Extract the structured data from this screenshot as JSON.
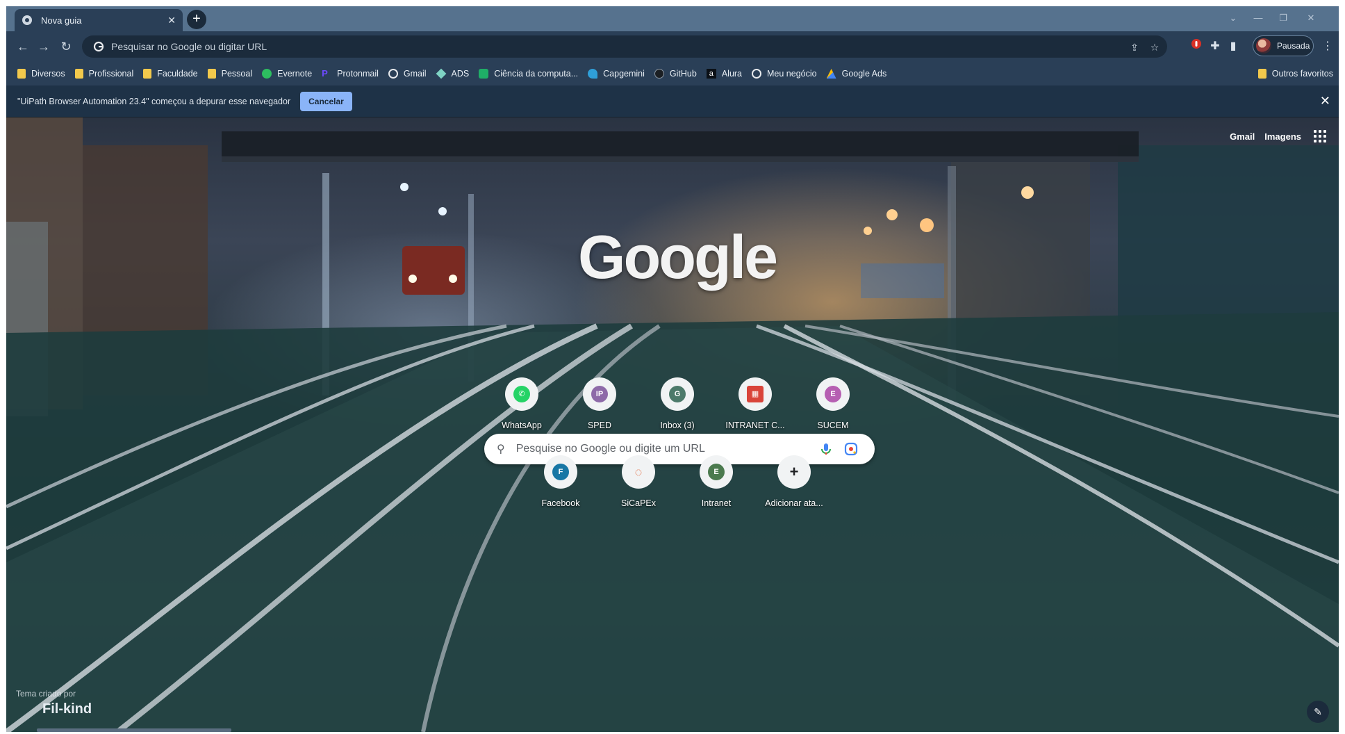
{
  "tab": {
    "title": "Nova guia",
    "close": "✕"
  },
  "window_controls": {
    "dropdown": "⌄",
    "minimize": "—",
    "restore": "❐",
    "close": "✕"
  },
  "toolbar": {
    "back": "←",
    "forward": "→",
    "reload": "↻",
    "omnibox_placeholder": "Pesquisar no Google ou digitar URL",
    "profile_label": "Pausada",
    "menu": "⋮"
  },
  "bookmarks": [
    {
      "label": "Diversos",
      "icon": "folder-icon"
    },
    {
      "label": "Profissional",
      "icon": "folder-icon"
    },
    {
      "label": "Faculdade",
      "icon": "folder-icon"
    },
    {
      "label": "Pessoal",
      "icon": "folder-icon"
    },
    {
      "label": "Evernote",
      "icon": "evernote-icon"
    },
    {
      "label": "Protonmail",
      "icon": "protonmail-icon"
    },
    {
      "label": "Gmail",
      "icon": "google-icon"
    },
    {
      "label": "ADS",
      "icon": "ads-icon"
    },
    {
      "label": "Ciência da computa...",
      "icon": "cc-icon"
    },
    {
      "label": "Capgemini",
      "icon": "capgemini-icon"
    },
    {
      "label": "GitHub",
      "icon": "github-icon"
    },
    {
      "label": "Alura",
      "icon": "alura-icon"
    },
    {
      "label": "Meu negócio",
      "icon": "google-icon"
    },
    {
      "label": "Google Ads",
      "icon": "google-ads-icon"
    }
  ],
  "other_bookmarks": "Outros favoritos",
  "infobar": {
    "message": "\"UiPath Browser Automation 23.4\" começou a depurar esse navegador",
    "cancel": "Cancelar",
    "close": "✕"
  },
  "ntp": {
    "top_links": {
      "gmail": "Gmail",
      "images": "Imagens"
    },
    "logo": "Google",
    "search_placeholder": "Pesquise no Google ou digite um URL",
    "shortcuts_row1": [
      {
        "label": "WhatsApp",
        "glyph": "✆",
        "color": "#25d366"
      },
      {
        "label": "SPED",
        "glyph": "IP",
        "color": "#8e6aa8"
      },
      {
        "label": "Inbox (3)",
        "glyph": "G",
        "color": "#4c7a6a"
      },
      {
        "label": "INTRANET C...",
        "glyph": "▦",
        "color": "#d9443a"
      },
      {
        "label": "SUCEM",
        "glyph": "E",
        "color": "#b65fb2"
      }
    ],
    "shortcuts_row2": [
      {
        "label": "Facebook",
        "glyph": "F",
        "color": "#1877a5"
      },
      {
        "label": "SiCaPEx",
        "glyph": "◌",
        "color": "#f1f3f4"
      },
      {
        "label": "Intranet",
        "glyph": "E",
        "color": "#4b7a4e"
      },
      {
        "label": "Adicionar ata...",
        "glyph": "+",
        "color": "#f1f3f4"
      }
    ],
    "theme_credit": {
      "created_by": "Tema criado por",
      "author": "Fil-kind"
    }
  },
  "colors": {
    "tabstrip": "#56728e",
    "toolbar": "#2a3f57",
    "accent_button": "#8ab4f8"
  }
}
